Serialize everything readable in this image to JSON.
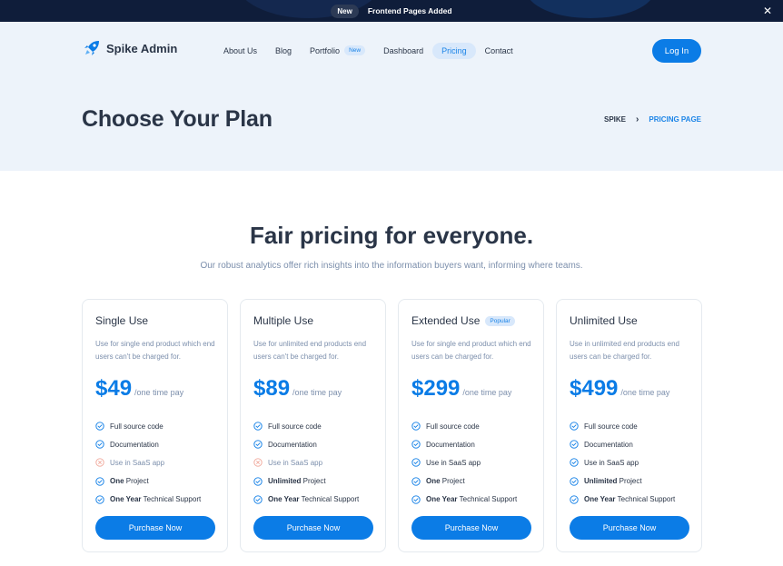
{
  "announcement": {
    "pill": "New",
    "message": "Frontend Pages Added",
    "close": "✕"
  },
  "brand": {
    "name": "Spike Admin"
  },
  "nav": [
    {
      "label": "About Us"
    },
    {
      "label": "Blog"
    },
    {
      "label": "Portfolio",
      "badge": "New"
    },
    {
      "label": "Dashboard"
    },
    {
      "label": "Pricing",
      "active": true
    },
    {
      "label": "Contact"
    }
  ],
  "login_label": "Log In",
  "page_title": "Choose Your Plan",
  "breadcrumb": {
    "root": "SPIKE",
    "separator": "›",
    "current": "PRICING PAGE"
  },
  "pricing": {
    "heading": "Fair pricing for everyone.",
    "subheading": "Our robust analytics offer rich insights into the information buyers want, informing where teams.",
    "plans": [
      {
        "name": "Single Use",
        "badge": "",
        "description": "Use for single end product which end users can't be charged for.",
        "price": "$49",
        "period": "/one time pay",
        "features": [
          {
            "bold": "",
            "text": "Full source code",
            "included": true
          },
          {
            "bold": "",
            "text": "Documentation",
            "included": true
          },
          {
            "bold": "",
            "text": "Use in SaaS app",
            "included": false
          },
          {
            "bold": "One",
            "text": " Project",
            "included": true
          },
          {
            "bold": "One Year",
            "text": " Technical Support",
            "included": true
          }
        ],
        "button": "Purchase Now"
      },
      {
        "name": "Multiple Use",
        "badge": "",
        "description": "Use for unlimited end products end users can't be charged for.",
        "price": "$89",
        "period": "/one time pay",
        "features": [
          {
            "bold": "",
            "text": "Full source code",
            "included": true
          },
          {
            "bold": "",
            "text": "Documentation",
            "included": true
          },
          {
            "bold": "",
            "text": "Use in SaaS app",
            "included": false
          },
          {
            "bold": "Unlimited",
            "text": " Project",
            "included": true
          },
          {
            "bold": "One Year",
            "text": " Technical Support",
            "included": true
          }
        ],
        "button": "Purchase Now"
      },
      {
        "name": "Extended Use",
        "badge": "Popular",
        "description": "Use for single end product which end users can be charged for.",
        "price": "$299",
        "period": "/one time pay",
        "features": [
          {
            "bold": "",
            "text": "Full source code",
            "included": true
          },
          {
            "bold": "",
            "text": "Documentation",
            "included": true
          },
          {
            "bold": "",
            "text": "Use in SaaS app",
            "included": true
          },
          {
            "bold": "One",
            "text": " Project",
            "included": true
          },
          {
            "bold": "One Year",
            "text": " Technical Support",
            "included": true
          }
        ],
        "button": "Purchase Now"
      },
      {
        "name": "Unlimited Use",
        "badge": "",
        "description": "Use in unlimited end products end users can be charged for.",
        "price": "$499",
        "period": "/one time pay",
        "features": [
          {
            "bold": "",
            "text": "Full source code",
            "included": true
          },
          {
            "bold": "",
            "text": "Documentation",
            "included": true
          },
          {
            "bold": "",
            "text": "Use in SaaS app",
            "included": true
          },
          {
            "bold": "Unlimited",
            "text": " Project",
            "included": true
          },
          {
            "bold": "One Year",
            "text": " Technical Support",
            "included": true
          }
        ],
        "button": "Purchase Now"
      }
    ]
  },
  "colors": {
    "primary": "#0b7ce6",
    "dark": "#2a3547",
    "muted": "#7c8fac",
    "hero_bg": "#edf3fa",
    "topbar_bg": "#0f1d3a",
    "excluded": "#f0a79a"
  },
  "icons": {
    "logo": "rocket-icon",
    "included": "check-circle-icon",
    "excluded": "x-circle-icon",
    "close": "close-icon"
  }
}
